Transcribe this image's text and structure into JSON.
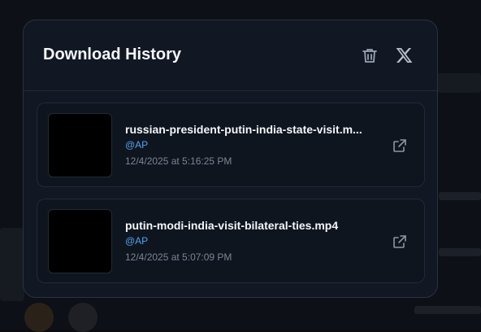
{
  "modal": {
    "title": "Download History",
    "clear_icon": "trash-icon",
    "close_icon": "x-close-icon"
  },
  "downloads": [
    {
      "filename": "russian-president-putin-india-state-visit.m...",
      "source": "@AP",
      "timestamp": "12/4/2025 at 5:16:25 PM",
      "action_icon": "external-link-icon"
    },
    {
      "filename": "putin-modi-india-visit-bilateral-ties.mp4",
      "source": "@AP",
      "timestamp": "12/4/2025 at 5:07:09 PM",
      "action_icon": "external-link-icon"
    }
  ],
  "colors": {
    "modal_bg": "#111723",
    "item_bg": "#0f151f",
    "accent_link": "#4fa2f0",
    "muted_text": "#7b8494"
  }
}
